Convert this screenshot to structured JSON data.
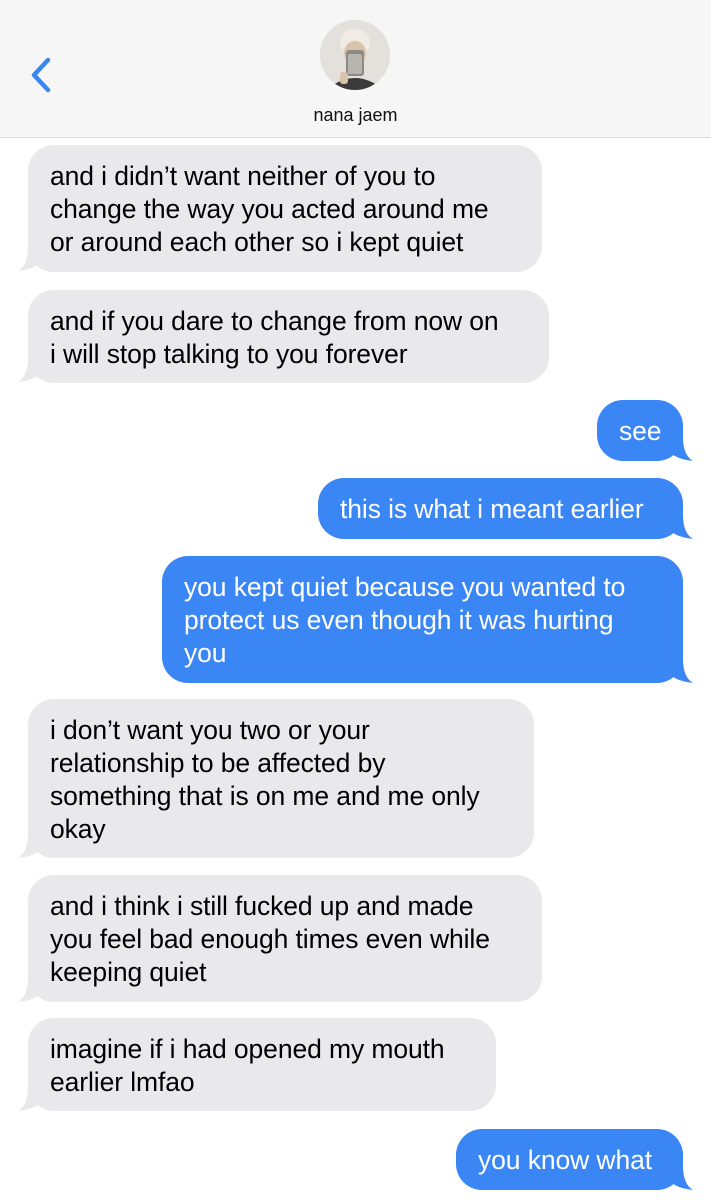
{
  "header": {
    "contact_name": "nana jaem",
    "back_icon": "chevron-left-icon"
  },
  "colors": {
    "sent_bubble": "#3a86f4",
    "received_bubble": "#e9e9eb",
    "accent": "#3a86f4"
  },
  "messages": [
    {
      "from": "contact",
      "text": "and i didn’t want neither of you to\nchange the way you acted around me\nor around each other so i kept quiet"
    },
    {
      "from": "contact",
      "text": "and if you dare to change from now on\ni will stop talking to you forever"
    },
    {
      "from": "me",
      "text": "see"
    },
    {
      "from": "me",
      "text": "this is what i meant earlier"
    },
    {
      "from": "me",
      "text": "you kept quiet because you wanted to\nprotect us even though it was hurting\nyou"
    },
    {
      "from": "contact",
      "text": "i don’t want you two or your\nrelationship to be affected by\nsomething that is on me and me only\nokay"
    },
    {
      "from": "contact",
      "text": "and i think i still fucked up and made\nyou feel bad enough times even while\nkeeping quiet"
    },
    {
      "from": "contact",
      "text": "imagine if i had opened my mouth\nearlier lmfao"
    },
    {
      "from": "me",
      "text": "you know what"
    }
  ]
}
